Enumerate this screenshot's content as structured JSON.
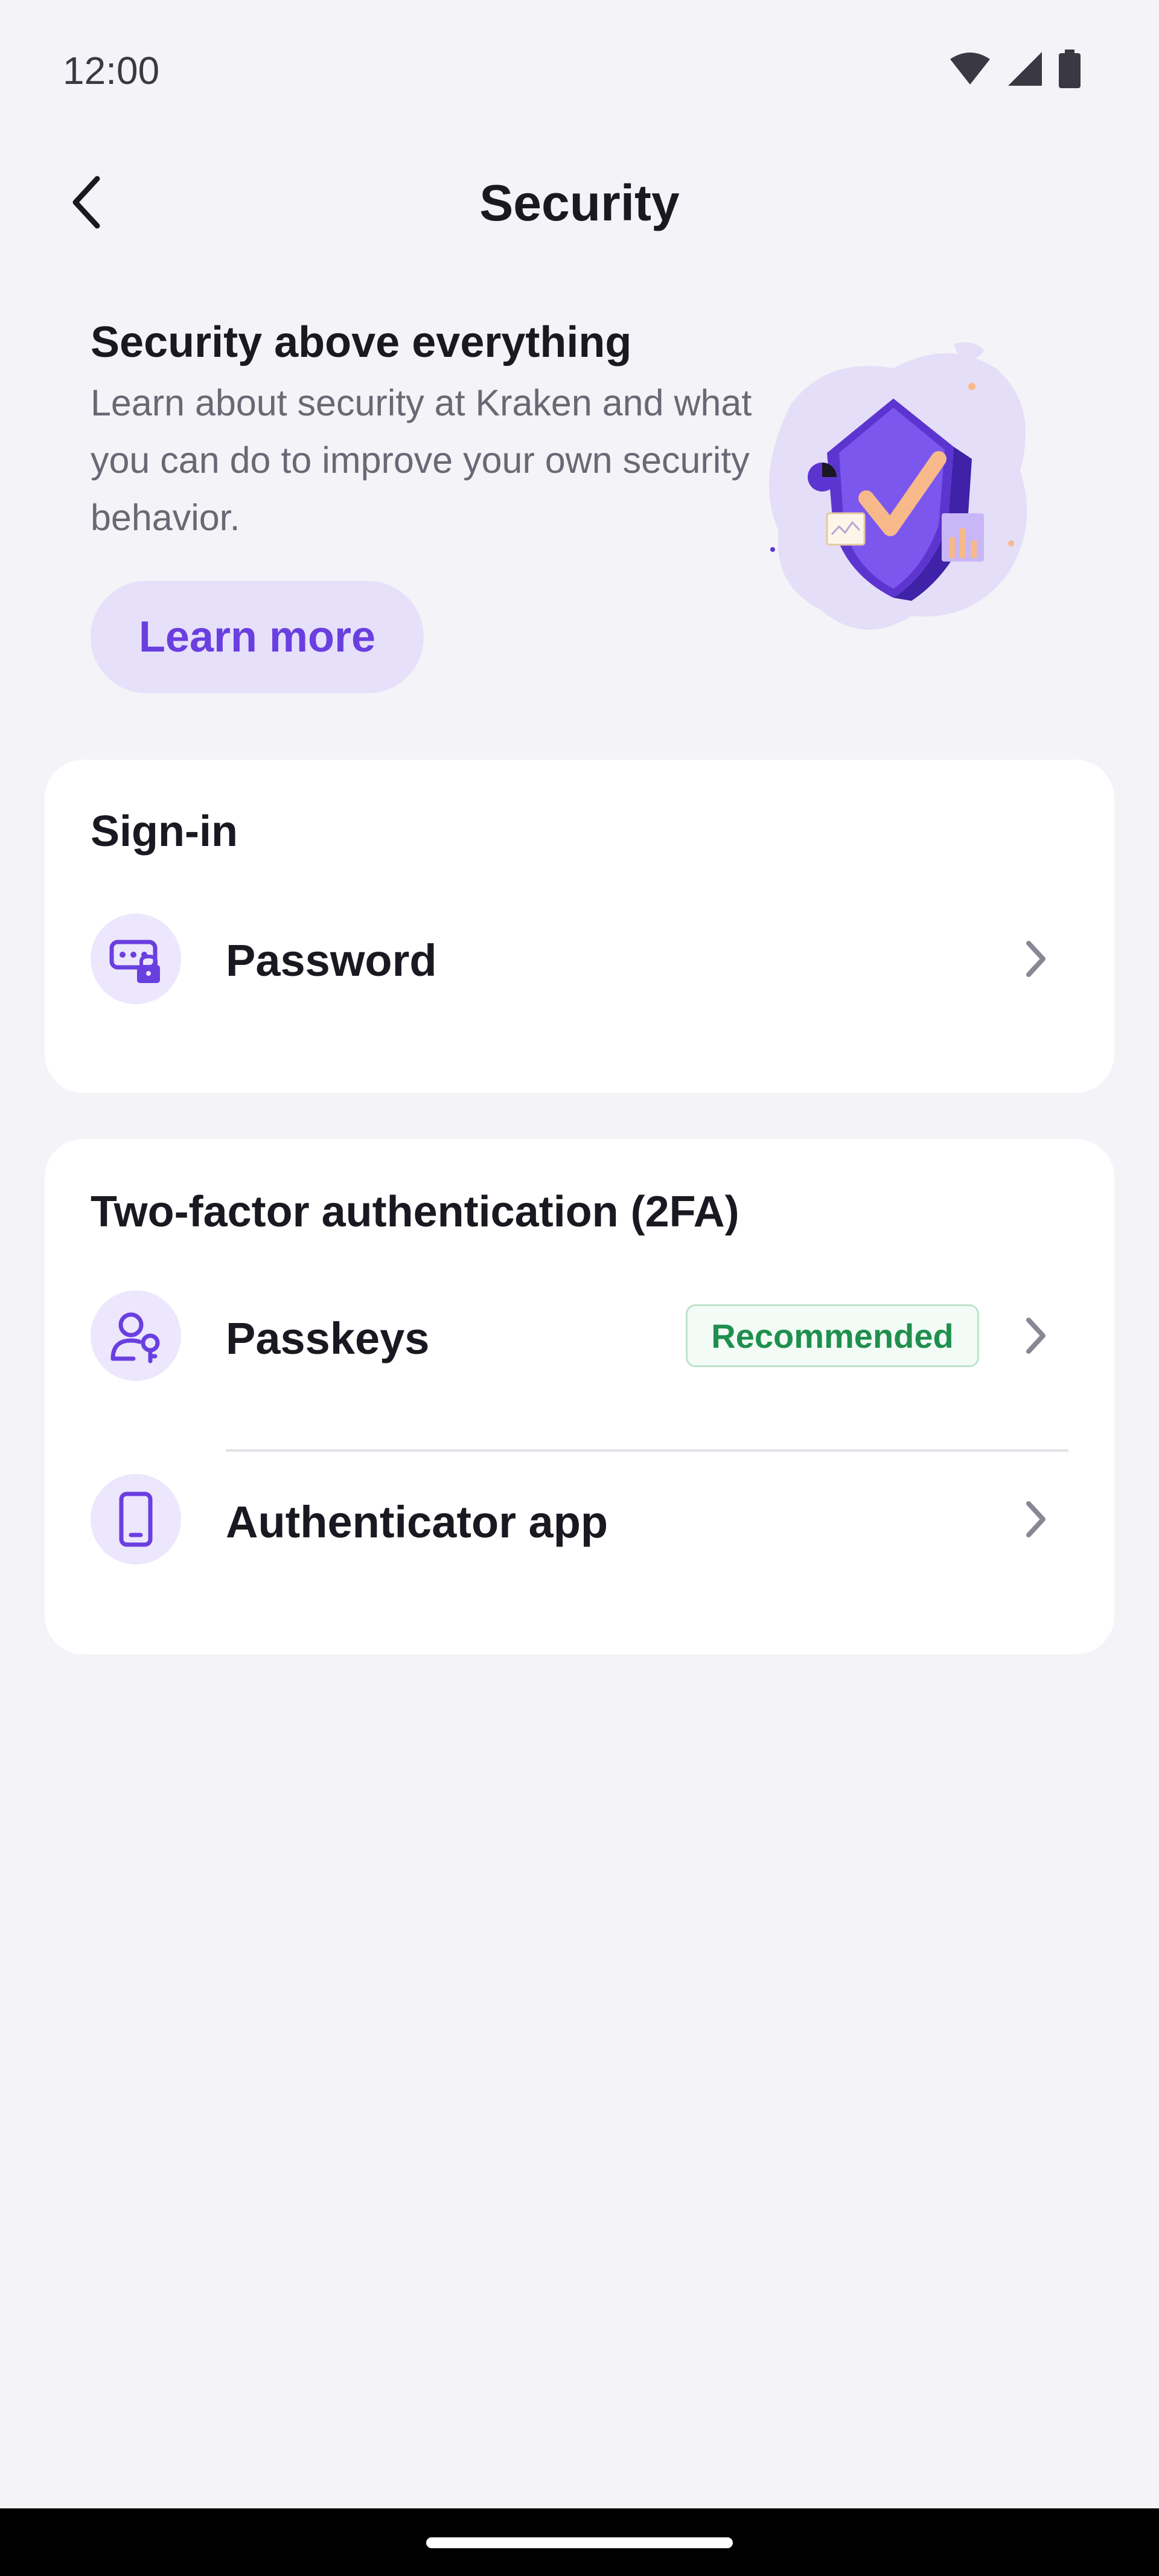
{
  "status_bar": {
    "time": "12:00"
  },
  "app_bar": {
    "title": "Security"
  },
  "promo": {
    "title": "Security above everything",
    "description": "Learn about security at Kraken and what you can do to improve your own security behavior.",
    "button_label": "Learn more"
  },
  "sign_in": {
    "title": "Sign-in",
    "items": [
      {
        "label": "Password",
        "icon": "password-lock-icon"
      }
    ]
  },
  "two_factor": {
    "title": "Two-factor authentication (2FA)",
    "items": [
      {
        "label": "Passkeys",
        "icon": "user-key-icon",
        "badge": "Recommended"
      },
      {
        "label": "Authenticator app",
        "icon": "smartphone-icon"
      }
    ]
  },
  "colors": {
    "accent": "#6a3fe0",
    "background": "#f4f3f8",
    "badge_green": "#1f8f4e"
  }
}
